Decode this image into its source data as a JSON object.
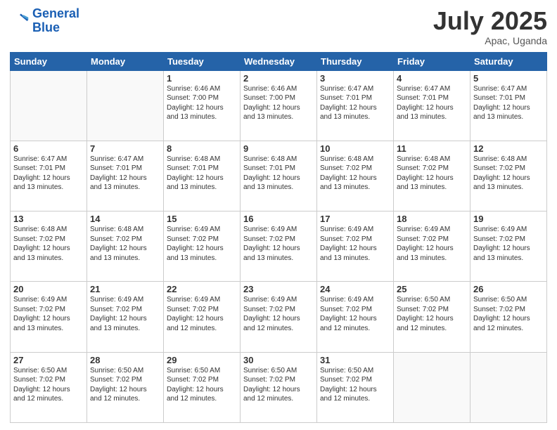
{
  "logo": {
    "line1": "General",
    "line2": "Blue"
  },
  "title": "July 2025",
  "subtitle": "Apac, Uganda",
  "weekdays": [
    "Sunday",
    "Monday",
    "Tuesday",
    "Wednesday",
    "Thursday",
    "Friday",
    "Saturday"
  ],
  "weeks": [
    [
      {
        "day": "",
        "info": ""
      },
      {
        "day": "",
        "info": ""
      },
      {
        "day": "1",
        "info": "Sunrise: 6:46 AM\nSunset: 7:00 PM\nDaylight: 12 hours and 13 minutes."
      },
      {
        "day": "2",
        "info": "Sunrise: 6:46 AM\nSunset: 7:00 PM\nDaylight: 12 hours and 13 minutes."
      },
      {
        "day": "3",
        "info": "Sunrise: 6:47 AM\nSunset: 7:01 PM\nDaylight: 12 hours and 13 minutes."
      },
      {
        "day": "4",
        "info": "Sunrise: 6:47 AM\nSunset: 7:01 PM\nDaylight: 12 hours and 13 minutes."
      },
      {
        "day": "5",
        "info": "Sunrise: 6:47 AM\nSunset: 7:01 PM\nDaylight: 12 hours and 13 minutes."
      }
    ],
    [
      {
        "day": "6",
        "info": "Sunrise: 6:47 AM\nSunset: 7:01 PM\nDaylight: 12 hours and 13 minutes."
      },
      {
        "day": "7",
        "info": "Sunrise: 6:47 AM\nSunset: 7:01 PM\nDaylight: 12 hours and 13 minutes."
      },
      {
        "day": "8",
        "info": "Sunrise: 6:48 AM\nSunset: 7:01 PM\nDaylight: 12 hours and 13 minutes."
      },
      {
        "day": "9",
        "info": "Sunrise: 6:48 AM\nSunset: 7:01 PM\nDaylight: 12 hours and 13 minutes."
      },
      {
        "day": "10",
        "info": "Sunrise: 6:48 AM\nSunset: 7:02 PM\nDaylight: 12 hours and 13 minutes."
      },
      {
        "day": "11",
        "info": "Sunrise: 6:48 AM\nSunset: 7:02 PM\nDaylight: 12 hours and 13 minutes."
      },
      {
        "day": "12",
        "info": "Sunrise: 6:48 AM\nSunset: 7:02 PM\nDaylight: 12 hours and 13 minutes."
      }
    ],
    [
      {
        "day": "13",
        "info": "Sunrise: 6:48 AM\nSunset: 7:02 PM\nDaylight: 12 hours and 13 minutes."
      },
      {
        "day": "14",
        "info": "Sunrise: 6:48 AM\nSunset: 7:02 PM\nDaylight: 12 hours and 13 minutes."
      },
      {
        "day": "15",
        "info": "Sunrise: 6:49 AM\nSunset: 7:02 PM\nDaylight: 12 hours and 13 minutes."
      },
      {
        "day": "16",
        "info": "Sunrise: 6:49 AM\nSunset: 7:02 PM\nDaylight: 12 hours and 13 minutes."
      },
      {
        "day": "17",
        "info": "Sunrise: 6:49 AM\nSunset: 7:02 PM\nDaylight: 12 hours and 13 minutes."
      },
      {
        "day": "18",
        "info": "Sunrise: 6:49 AM\nSunset: 7:02 PM\nDaylight: 12 hours and 13 minutes."
      },
      {
        "day": "19",
        "info": "Sunrise: 6:49 AM\nSunset: 7:02 PM\nDaylight: 12 hours and 13 minutes."
      }
    ],
    [
      {
        "day": "20",
        "info": "Sunrise: 6:49 AM\nSunset: 7:02 PM\nDaylight: 12 hours and 13 minutes."
      },
      {
        "day": "21",
        "info": "Sunrise: 6:49 AM\nSunset: 7:02 PM\nDaylight: 12 hours and 13 minutes."
      },
      {
        "day": "22",
        "info": "Sunrise: 6:49 AM\nSunset: 7:02 PM\nDaylight: 12 hours and 12 minutes."
      },
      {
        "day": "23",
        "info": "Sunrise: 6:49 AM\nSunset: 7:02 PM\nDaylight: 12 hours and 12 minutes."
      },
      {
        "day": "24",
        "info": "Sunrise: 6:49 AM\nSunset: 7:02 PM\nDaylight: 12 hours and 12 minutes."
      },
      {
        "day": "25",
        "info": "Sunrise: 6:50 AM\nSunset: 7:02 PM\nDaylight: 12 hours and 12 minutes."
      },
      {
        "day": "26",
        "info": "Sunrise: 6:50 AM\nSunset: 7:02 PM\nDaylight: 12 hours and 12 minutes."
      }
    ],
    [
      {
        "day": "27",
        "info": "Sunrise: 6:50 AM\nSunset: 7:02 PM\nDaylight: 12 hours and 12 minutes."
      },
      {
        "day": "28",
        "info": "Sunrise: 6:50 AM\nSunset: 7:02 PM\nDaylight: 12 hours and 12 minutes."
      },
      {
        "day": "29",
        "info": "Sunrise: 6:50 AM\nSunset: 7:02 PM\nDaylight: 12 hours and 12 minutes."
      },
      {
        "day": "30",
        "info": "Sunrise: 6:50 AM\nSunset: 7:02 PM\nDaylight: 12 hours and 12 minutes."
      },
      {
        "day": "31",
        "info": "Sunrise: 6:50 AM\nSunset: 7:02 PM\nDaylight: 12 hours and 12 minutes."
      },
      {
        "day": "",
        "info": ""
      },
      {
        "day": "",
        "info": ""
      }
    ]
  ]
}
